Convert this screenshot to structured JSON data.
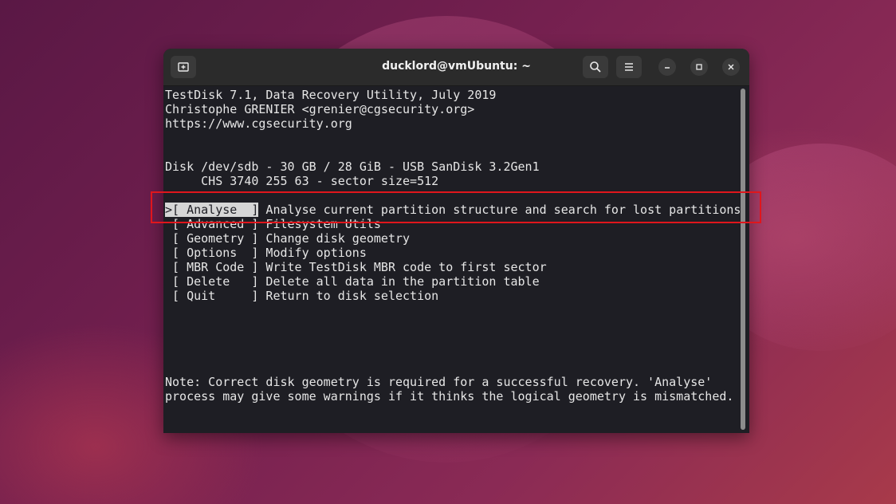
{
  "window": {
    "title": "ducklord@vmUbuntu: ~",
    "new_tab_icon": "new-tab-icon",
    "search_icon": "search-icon",
    "menu_icon": "hamburger-menu-icon",
    "minimize_icon": "minimize-icon",
    "maximize_icon": "maximize-icon",
    "close_icon": "close-icon"
  },
  "terminal": {
    "header": [
      "TestDisk 7.1, Data Recovery Utility, July 2019",
      "Christophe GRENIER <grenier@cgsecurity.org>",
      "https://www.cgsecurity.org"
    ],
    "disk_line": "Disk /dev/sdb - 30 GB / 28 GiB - USB SanDisk 3.2Gen1",
    "chs_line": "     CHS 3740 255 63 - sector size=512",
    "selected_marker": ">",
    "menu": [
      {
        "label": "[ Analyse  ]",
        "desc": " Analyse current partition structure and search for lost partitions"
      },
      {
        "label": " [ Advanced ]",
        "desc": " Filesystem Utils"
      },
      {
        "label": " [ Geometry ]",
        "desc": " Change disk geometry"
      },
      {
        "label": " [ Options  ]",
        "desc": " Modify options"
      },
      {
        "label": " [ MBR Code ]",
        "desc": " Write TestDisk MBR code to first sector"
      },
      {
        "label": " [ Delete   ]",
        "desc": " Delete all data in the partition table"
      },
      {
        "label": " [ Quit     ]",
        "desc": " Return to disk selection"
      }
    ],
    "note": [
      "Note: Correct disk geometry is required for a successful recovery. 'Analyse'",
      "process may give some warnings if it thinks the logical geometry is mismatched."
    ]
  },
  "colors": {
    "highlight_box": "#e0161c",
    "terminal_bg": "#1e1e24",
    "terminal_fg": "#e6e6e6"
  }
}
